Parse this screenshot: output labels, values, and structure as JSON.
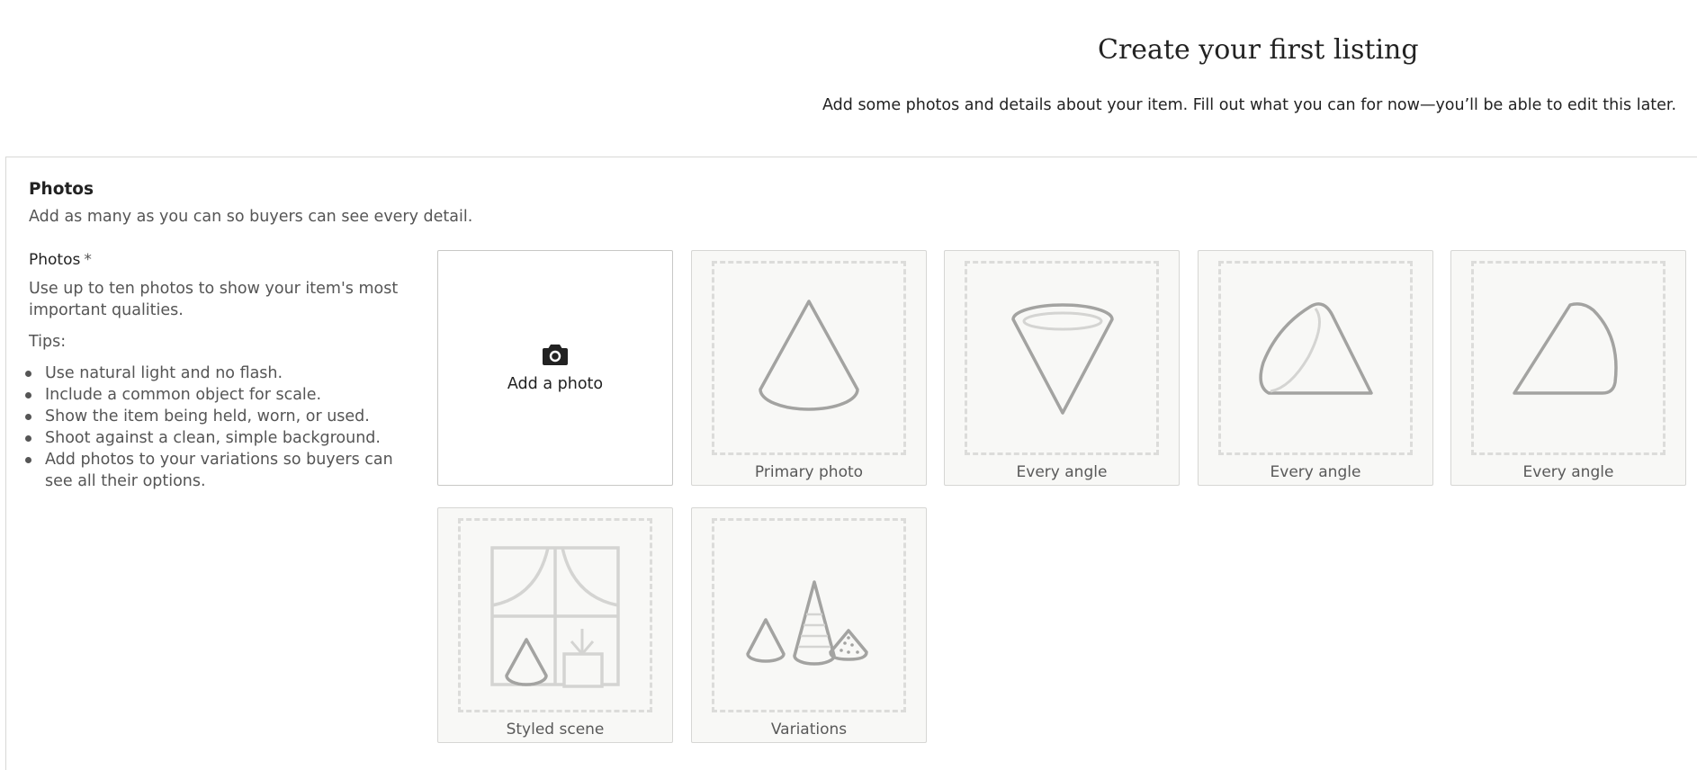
{
  "header": {
    "title": "Create your first listing",
    "subtitle": "Add some photos and details about your item. Fill out what you can for now—you’ll be able to edit this later."
  },
  "photos_section": {
    "title": "Photos",
    "description": "Add as many as you can so buyers can see every detail.",
    "field_label": "Photos",
    "required_mark": "*",
    "help_text": "Use up to ten photos to show your item's most important qualities.",
    "tips_label": "Tips:",
    "tips": [
      "Use natural light and no flash.",
      "Include a common object for scale.",
      "Show the item being held, worn, or used.",
      "Shoot against a clean, simple background.",
      "Add photos to your variations so buyers can see all their options."
    ],
    "add_photo_label": "Add a photo",
    "add_photo_icon": "camera-icon",
    "slots": [
      {
        "caption": "Primary photo",
        "icon": "cone-front-icon"
      },
      {
        "caption": "Every angle",
        "icon": "cone-top-icon"
      },
      {
        "caption": "Every angle",
        "icon": "cone-side-icon"
      },
      {
        "caption": "Every angle",
        "icon": "cone-profile-icon"
      },
      {
        "caption": "Styled scene",
        "icon": "styled-scene-icon"
      },
      {
        "caption": "Variations",
        "icon": "variations-icon"
      }
    ]
  },
  "colors": {
    "text": "#222222",
    "muted_text": "#555555",
    "tile_bg": "#f8f8f6",
    "tile_border": "#d6d6d4",
    "dash": "#dcdcda",
    "illustration": "#a3a3a1"
  }
}
